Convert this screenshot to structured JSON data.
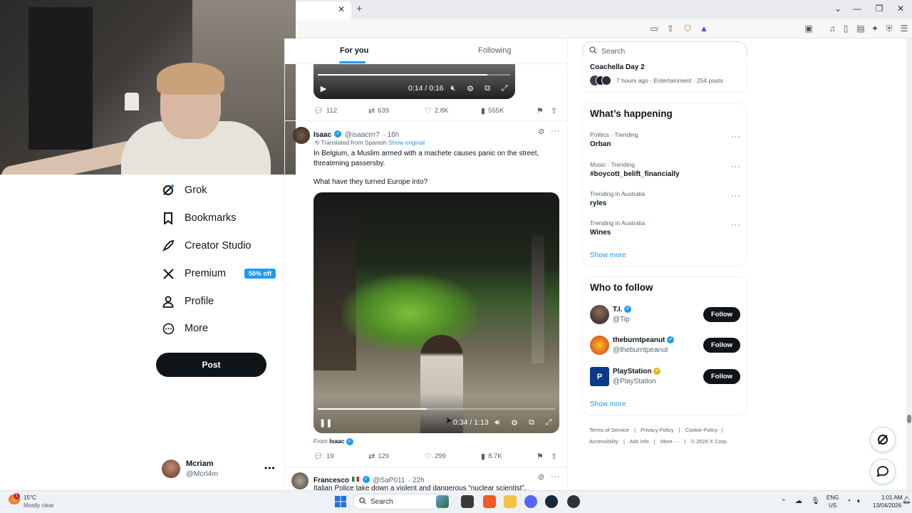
{
  "timeline": {
    "tabs": [
      {
        "label": "For you",
        "active": true
      },
      {
        "label": "Following",
        "active": false
      }
    ],
    "video1": {
      "time": "0:14 / 0:16",
      "progress": 0.88
    },
    "tweet1_actions": {
      "replies": "112",
      "reposts": "639",
      "likes": "2.8K",
      "views": "555K"
    },
    "tweet2": {
      "name": "Isaac",
      "handle": "@isaacrrr7",
      "time": "· 16h",
      "translated": "Translated from Spanish",
      "show_original": "Show original",
      "text1": "In Belgium, a Muslim armed with a machete causes panic on the street, threatening passersby.",
      "text2": "What have they turned Europe into?",
      "video_time": "0:34 / 1:13",
      "video_progress": 0.46,
      "from_label": "From",
      "from_name": "Isaac",
      "replies": "19",
      "reposts": "129",
      "likes": "299",
      "views": "8.7K"
    },
    "tweet3": {
      "name": "Francesco",
      "handle": "@SaP011",
      "time": "· 22h",
      "text": "Italian Police take down a violent and dangerous “nuclear scientist”."
    }
  },
  "nav": {
    "items": [
      {
        "label": "Grok",
        "icon": "grok-icon"
      },
      {
        "label": "Bookmarks",
        "icon": "bookmark-icon"
      },
      {
        "label": "Creator Studio",
        "icon": "rocket-icon"
      },
      {
        "label": "Premium",
        "icon": "x-logo-icon",
        "badge": "50% off"
      },
      {
        "label": "Profile",
        "icon": "person-icon"
      },
      {
        "label": "More",
        "icon": "more-circle-icon"
      }
    ],
    "post_label": "Post",
    "account": {
      "name": "Mcriam",
      "handle": "@Mcrl4m"
    }
  },
  "right": {
    "search_placeholder": "Search",
    "top_trend": {
      "name": "Coachella Day 2",
      "meta": "7 hours ago · Entertainment · 254 posts"
    },
    "happening": {
      "title": "What’s happening",
      "trends": [
        {
          "category": "Politics · Trending",
          "name": "Orban"
        },
        {
          "category": "Music · Trending",
          "name": "#boycott_belift_financially"
        },
        {
          "category": "Trending in Australia",
          "name": "ryles"
        },
        {
          "category": "Trending in Australia",
          "name": "Wines"
        }
      ],
      "show_more": "Show more"
    },
    "who_to_follow": {
      "title": "Who to follow",
      "accounts": [
        {
          "name": "T.I.",
          "handle": "@Tip",
          "verified": "blue"
        },
        {
          "name": "theburntpeanut",
          "handle": "@theburntpeanut",
          "verified": "blue"
        },
        {
          "name": "PlayStation",
          "handle": "@PlayStation",
          "verified": "gold"
        }
      ],
      "follow_label": "Follow",
      "show_more": "Show more"
    },
    "footer": {
      "line1": [
        "Terms of Service",
        "Privacy Policy",
        "Cookie Policy"
      ],
      "line2": [
        "Accessibility",
        "Ads info",
        "More ···",
        "© 2026 X Corp."
      ]
    }
  },
  "taskbar": {
    "weather_temp": "15°C",
    "weather_desc": "Mostly clear",
    "search_label": "Search",
    "lang1": "ENG",
    "lang2": "US",
    "time": "1:01 AM",
    "date": "13/04/2026"
  },
  "colors": {
    "accent": "#1d9bf0",
    "text": "#0f1419",
    "muted": "#536471",
    "button": "#0f1419"
  }
}
